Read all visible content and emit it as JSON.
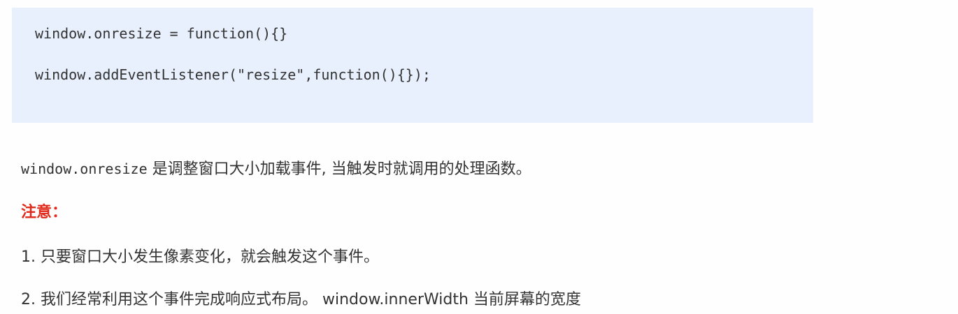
{
  "code": {
    "line1": "window.onresize = function(){}",
    "line2": "window.addEventListener(\"resize\",function(){});"
  },
  "description": {
    "code_term": "window.onresize",
    "text": " 是调整窗口大小加载事件, 当触发时就调用的处理函数。"
  },
  "note_label": "注意：",
  "items": [
    "1. 只要窗口大小发生像素变化，就会触发这个事件。",
    "2. 我们经常利用这个事件完成响应式布局。 window.innerWidth 当前屏幕的宽度"
  ],
  "colors": {
    "code_background": "#e8f0fd",
    "note_red": "#e02a1b",
    "text": "#333333"
  }
}
